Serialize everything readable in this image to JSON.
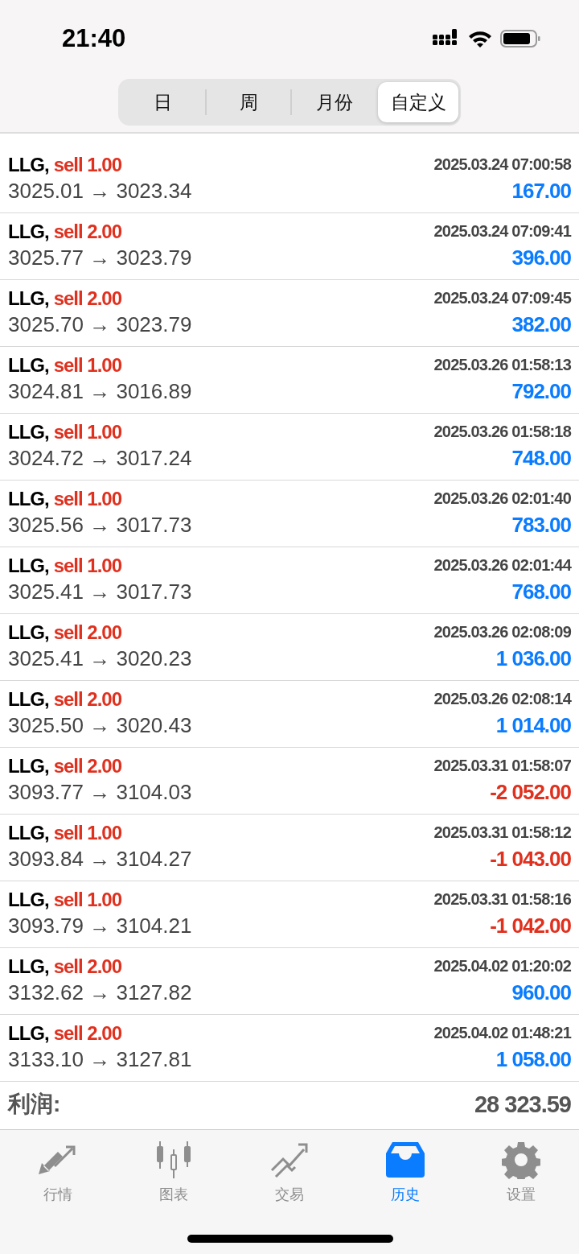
{
  "status_bar": {
    "time": "21:40"
  },
  "segments": [
    {
      "label": "日",
      "selected": false
    },
    {
      "label": "周",
      "selected": false
    },
    {
      "label": "月份",
      "selected": false
    },
    {
      "label": "自定义",
      "selected": true
    }
  ],
  "deals": [
    {
      "symbol": "LLG,",
      "order": "sell 1.00",
      "time": "2025.03.24 07:00:58",
      "prices": "3025.01 → 3023.34",
      "profit": "167.00",
      "loss": false
    },
    {
      "symbol": "LLG,",
      "order": "sell 2.00",
      "time": "2025.03.24 07:09:41",
      "prices": "3025.77 → 3023.79",
      "profit": "396.00",
      "loss": false
    },
    {
      "symbol": "LLG,",
      "order": "sell 2.00",
      "time": "2025.03.24 07:09:45",
      "prices": "3025.70 → 3023.79",
      "profit": "382.00",
      "loss": false
    },
    {
      "symbol": "LLG,",
      "order": "sell 1.00",
      "time": "2025.03.26 01:58:13",
      "prices": "3024.81 → 3016.89",
      "profit": "792.00",
      "loss": false
    },
    {
      "symbol": "LLG,",
      "order": "sell 1.00",
      "time": "2025.03.26 01:58:18",
      "prices": "3024.72 → 3017.24",
      "profit": "748.00",
      "loss": false
    },
    {
      "symbol": "LLG,",
      "order": "sell 1.00",
      "time": "2025.03.26 02:01:40",
      "prices": "3025.56 → 3017.73",
      "profit": "783.00",
      "loss": false
    },
    {
      "symbol": "LLG,",
      "order": "sell 1.00",
      "time": "2025.03.26 02:01:44",
      "prices": "3025.41 → 3017.73",
      "profit": "768.00",
      "loss": false
    },
    {
      "symbol": "LLG,",
      "order": "sell 2.00",
      "time": "2025.03.26 02:08:09",
      "prices": "3025.41 → 3020.23",
      "profit": "1 036.00",
      "loss": false
    },
    {
      "symbol": "LLG,",
      "order": "sell 2.00",
      "time": "2025.03.26 02:08:14",
      "prices": "3025.50 → 3020.43",
      "profit": "1 014.00",
      "loss": false
    },
    {
      "symbol": "LLG,",
      "order": "sell 2.00",
      "time": "2025.03.31 01:58:07",
      "prices": "3093.77 → 3104.03",
      "profit": "-2 052.00",
      "loss": true
    },
    {
      "symbol": "LLG,",
      "order": "sell 1.00",
      "time": "2025.03.31 01:58:12",
      "prices": "3093.84 → 3104.27",
      "profit": "-1 043.00",
      "loss": true
    },
    {
      "symbol": "LLG,",
      "order": "sell 1.00",
      "time": "2025.03.31 01:58:16",
      "prices": "3093.79 → 3104.21",
      "profit": "-1 042.00",
      "loss": true
    },
    {
      "symbol": "LLG,",
      "order": "sell 2.00",
      "time": "2025.04.02 01:20:02",
      "prices": "3132.62 → 3127.82",
      "profit": "960.00",
      "loss": false
    },
    {
      "symbol": "LLG,",
      "order": "sell 2.00",
      "time": "2025.04.02 01:48:21",
      "prices": "3133.10 → 3127.81",
      "profit": "1 058.00",
      "loss": false
    }
  ],
  "summary": {
    "label": "利润:",
    "value": "28 323.59"
  },
  "tab_bar": [
    {
      "label": "行情",
      "kind": "quotes",
      "selected": false
    },
    {
      "label": "图表",
      "kind": "chart",
      "selected": false
    },
    {
      "label": "交易",
      "kind": "trade",
      "selected": false
    },
    {
      "label": "历史",
      "kind": "history",
      "selected": true
    },
    {
      "label": "设置",
      "kind": "settings",
      "selected": false
    }
  ]
}
